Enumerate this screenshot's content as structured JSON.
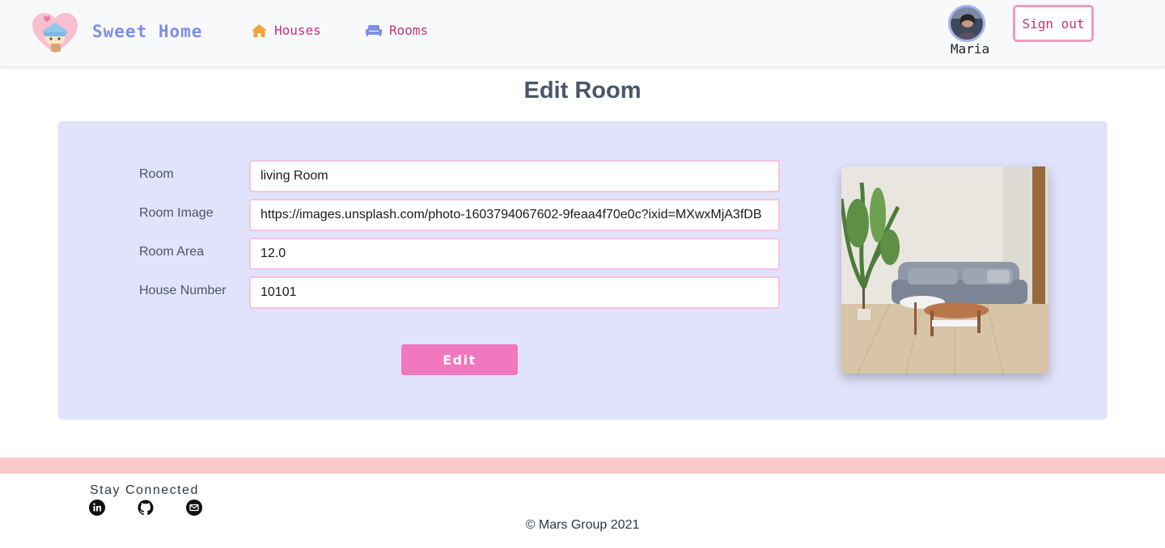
{
  "header": {
    "brand": "Sweet Home",
    "nav": [
      {
        "label": "Houses",
        "icon": "house-icon",
        "icon_color": "#f0a33a"
      },
      {
        "label": "Rooms",
        "icon": "sofa-icon",
        "icon_color": "#7f8ee8"
      }
    ],
    "user": {
      "name": "Maria",
      "avatar": "avatar"
    },
    "signout_label": "Sign out"
  },
  "page": {
    "title": "Edit Room"
  },
  "form": {
    "fields": [
      {
        "label": "Room",
        "value": "living Room"
      },
      {
        "label": "Room Image",
        "value": "https://images.unsplash.com/photo-1603794067602-9feaa4f70e0c?ixid=MXwxMjA3fDB"
      },
      {
        "label": "Room Area",
        "value": "12.0"
      },
      {
        "label": "House Number",
        "value": "10101"
      }
    ],
    "submit_label": "Edit"
  },
  "footer": {
    "stay_connected": "Stay Connected",
    "social": [
      "linkedin-icon",
      "github-icon",
      "mail-icon"
    ],
    "copyright": "© Mars Group 2021"
  },
  "colors": {
    "accent_pink": "#f177be",
    "card_bg": "#e0e3fb",
    "footer_bar": "#f8caca",
    "brand": "#7f8ee8",
    "nav_text": "#c0357a"
  }
}
